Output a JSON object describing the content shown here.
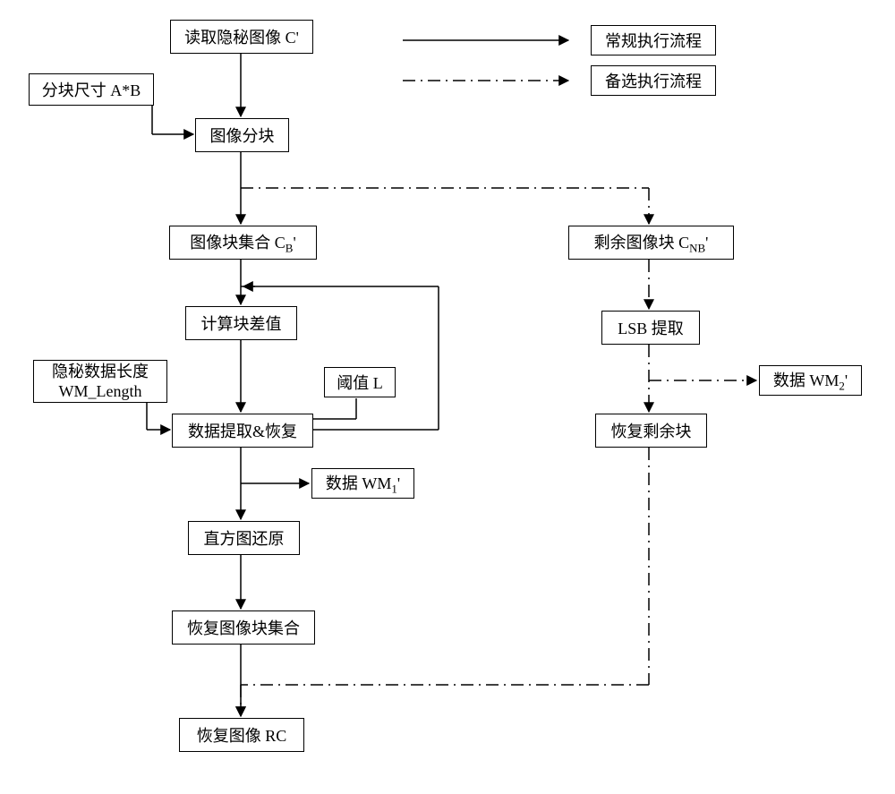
{
  "legend": {
    "normal": "常规执行流程",
    "alternative": "备选执行流程"
  },
  "nodes": {
    "read_stego_image": "读取隐秘图像 C'",
    "block_size": "分块尺寸 A*B",
    "image_blocking": "图像分块",
    "block_set": "图像块集合 C",
    "block_set_sub": "B",
    "block_set_tail": "'",
    "remaining_blocks": "剩余图像块 C",
    "remaining_blocks_sub": "NB",
    "remaining_blocks_tail": "'",
    "calc_block_diff": "计算块差值",
    "secret_len_line1": "隐秘数据长度",
    "secret_len_line2": "WM_Length",
    "threshold": "阈值 L",
    "extract_restore": "数据提取&恢复",
    "wm1_prefix": "数据 WM",
    "wm1_sub": "1",
    "wm1_tail": "'",
    "hist_restore": "直方图还原",
    "restore_block_set": "恢复图像块集合",
    "restore_image": "恢复图像 RC",
    "lsb_extract": "LSB 提取",
    "wm2_prefix": "数据 WM",
    "wm2_sub": "2",
    "wm2_tail": "'",
    "restore_remaining": "恢复剩余块"
  }
}
